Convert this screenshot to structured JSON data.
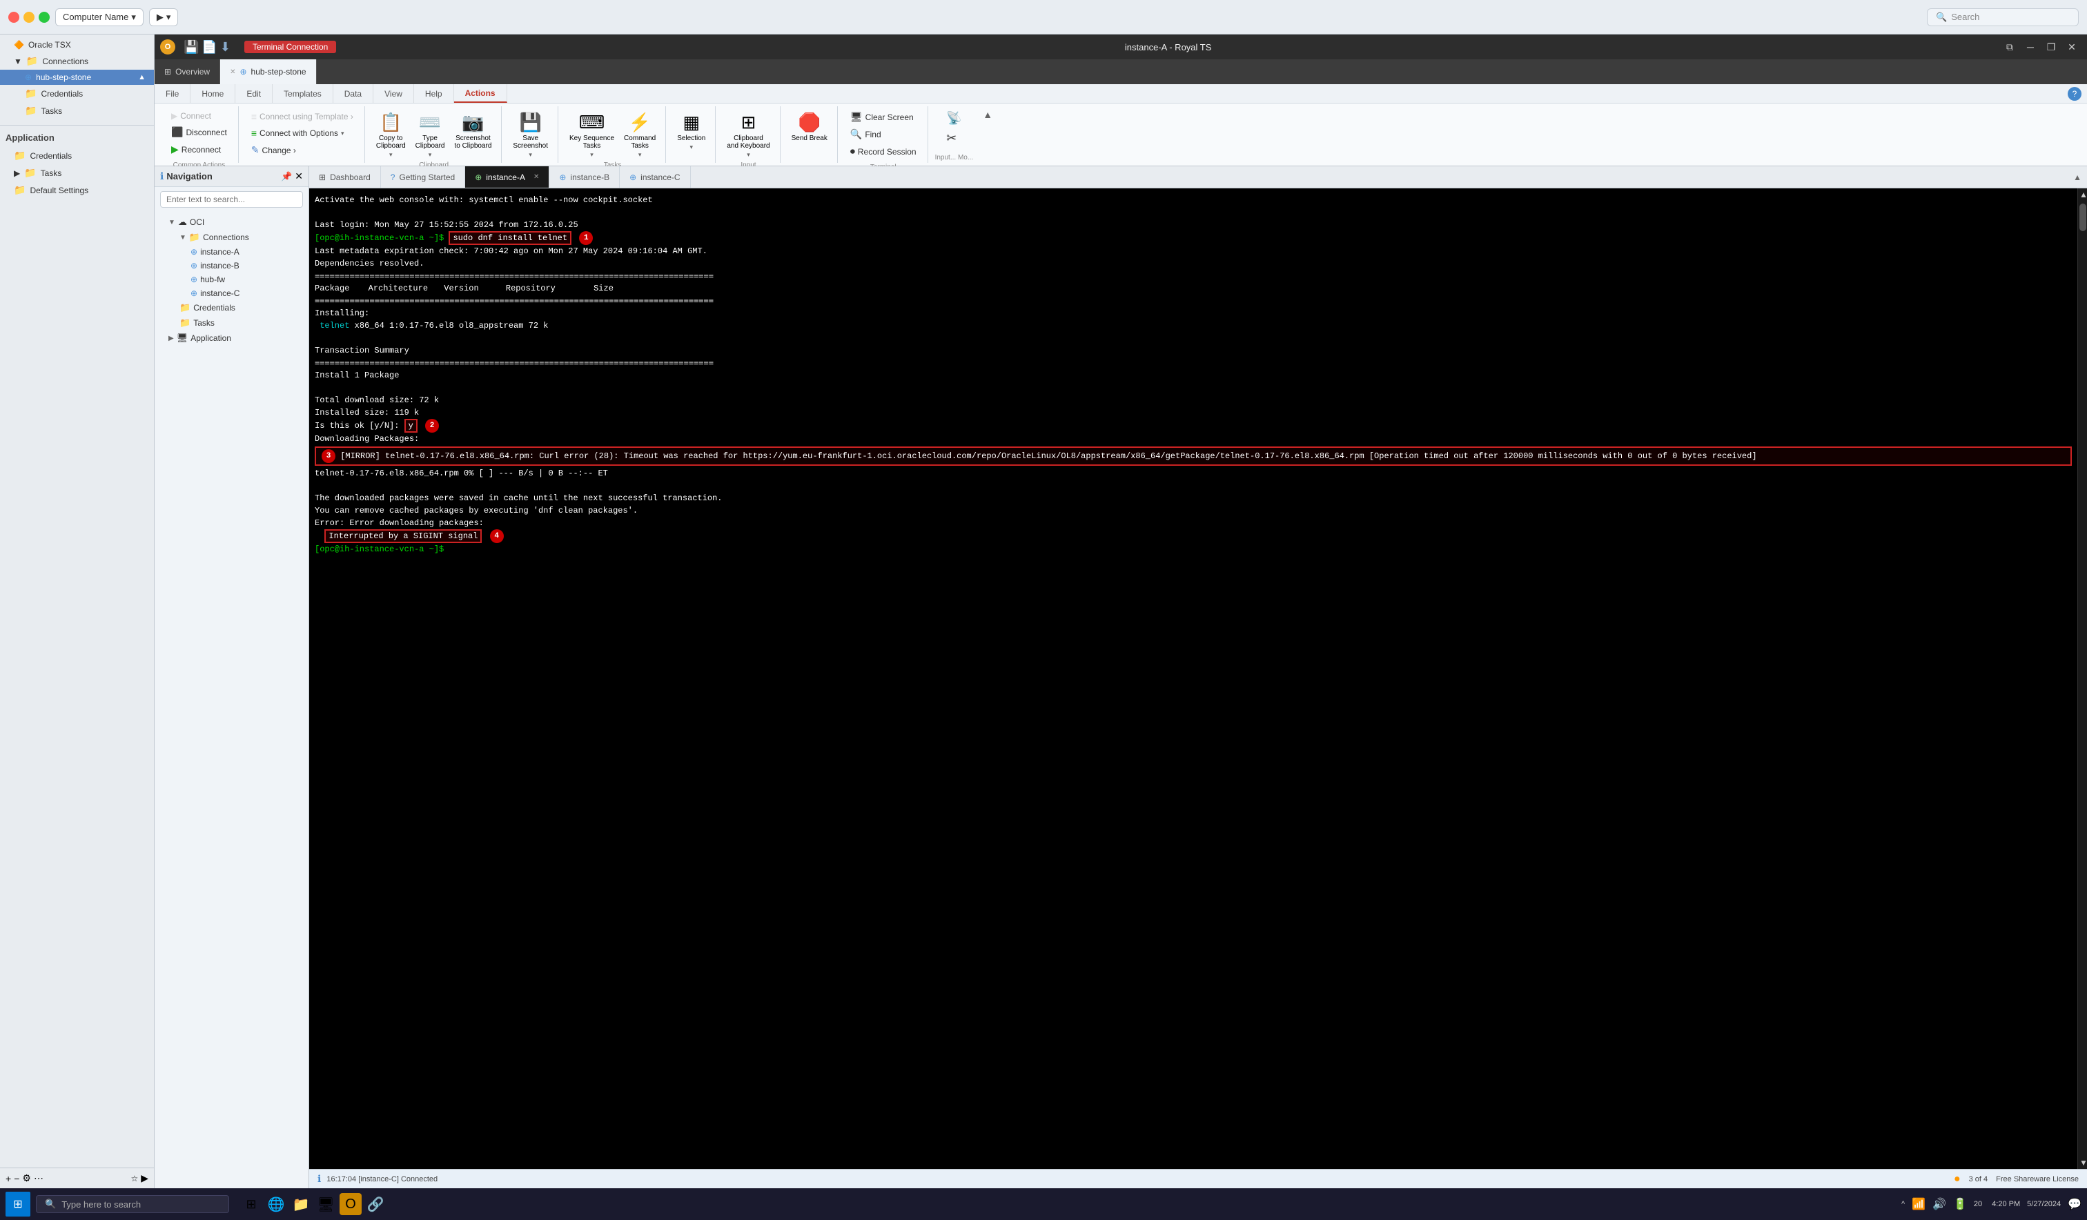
{
  "titlebar": {
    "computer_name": "Computer Name",
    "search_placeholder": "Search"
  },
  "sidebar": {
    "oracle_tsx": "Oracle TSX",
    "connections": "Connections",
    "hub_step_stone": "hub-step-stone",
    "credentials": "Credentials",
    "tasks": "Tasks",
    "application": "Application",
    "app_credentials": "Credentials",
    "app_tasks": "Tasks",
    "default_settings": "Default Settings"
  },
  "rts_window": {
    "title": "instance-A - Royal TS",
    "tab_overview": "Overview",
    "tab_hub": "hub-step-stone",
    "session_label": "Terminal Connection"
  },
  "ribbon": {
    "tabs": [
      "File",
      "Home",
      "Edit",
      "Templates",
      "Data",
      "View",
      "Help",
      "Actions"
    ],
    "active_tab": "Actions",
    "connect": "Connect",
    "disconnect": "Disconnect",
    "reconnect": "Reconnect",
    "connect_template": "Connect using Template ›",
    "connect_options": "Connect with Options",
    "change": "Change ›",
    "common_actions": "Common Actions",
    "copy_to_clipboard": "Copy to\nClipboard",
    "type_clipboard": "Type\nClipboard",
    "screenshot_clipboard": "Screenshot\nto Clipboard",
    "save_screenshot": "Save\nScreenshot",
    "key_sequence": "Key Sequence\nTasks",
    "command_tasks": "Command\nTasks",
    "selection": "Selection",
    "clipboard_keyboard": "Clipboard\nand Keyboard",
    "send_break": "Send Break",
    "clipboard_group": "Clipboard",
    "tasks_group": "Tasks",
    "input_group": "Input",
    "terminal_group": "Terminal",
    "clear_screen": "Clear Screen",
    "find": "Find",
    "record_session": "Record Session",
    "copy_label": "to Clipboard Copy"
  },
  "navigation": {
    "title": "Navigation",
    "search_placeholder": "Enter text to search...",
    "oci": "OCI",
    "connections": "Connections",
    "instance_a": "instance-A",
    "instance_b": "instance-B",
    "hub_fw": "hub-fw",
    "instance_c": "instance-C",
    "credentials": "Credentials",
    "tasks": "Tasks",
    "application": "Application"
  },
  "terminal_tabs": {
    "dashboard": "Dashboard",
    "getting_started": "Getting Started",
    "instance_a": "instance-A",
    "instance_b": "instance-B",
    "instance_c": "instance-C"
  },
  "terminal": {
    "line1": "Activate the web console with: systemctl enable --now cockpit.socket",
    "line2": "",
    "line3": "Last login: Mon May 27 15:52:55 2024 from 172.16.0.25",
    "line4": "[opc@ih-instance-vcn-a ~]$ sudo dnf install telnet",
    "line5": "Last metadata expiration check: 7:00:42 ago on Mon 27 May 2024 09:16:04 AM GMT.",
    "line6": "Dependencies resolved.",
    "line7": "================================================================================",
    "line8": "Package                    Architecture         Version               Repository               Size",
    "line9": "================================================================================",
    "line10": "Installing:",
    "line11": " telnet                     x86_64               1:0.17-76.el8         ol8_appstream            72 k",
    "line12": "",
    "line13": "Transaction Summary",
    "line14": "================================================================================",
    "line15": "Install  1 Package",
    "line16": "",
    "line17": "Total download size: 72 k",
    "line18": "Installed size: 119 k",
    "line19": "Is this ok [y/N]: y",
    "line20": "Downloading Packages:",
    "line21": "[MIRROR] telnet-0.17-76.el8.x86_64.rpm: Curl error (28): Timeout was reached for https://yum.eu-frankfurt-1.oci.oraclecloud.com/repo/OracleLinux/OL8/appstream/x86_64/getPackage/telnet-0.17-76.el8.x86_64.rpm [Operation timed out after 120000 milliseconds with 0 out of 0 bytes received]",
    "line22": " telnet-0.17-76.el8.x86_64.rpm                         0% [                                ] ---  B/s |   0  B     --:-- ET",
    "line23": "",
    "line24": "The downloaded packages were saved in cache until the next successful transaction.",
    "line25": "You can remove cached packages by executing 'dnf clean packages'.",
    "line26": "Error: Error downloading packages:",
    "line27": "  Interrupted by a SIGINT signal",
    "line28": "[opc@ih-instance-vcn-a ~]$ "
  },
  "status_bar": {
    "message": "16:17:04 [instance-C] Connected",
    "pages": "3 of 4",
    "license": "Free Shareware License"
  },
  "taskbar": {
    "search_placeholder": "Type here to search",
    "time": "4:20 PM",
    "date": "5/27/2024",
    "battery": "20"
  }
}
